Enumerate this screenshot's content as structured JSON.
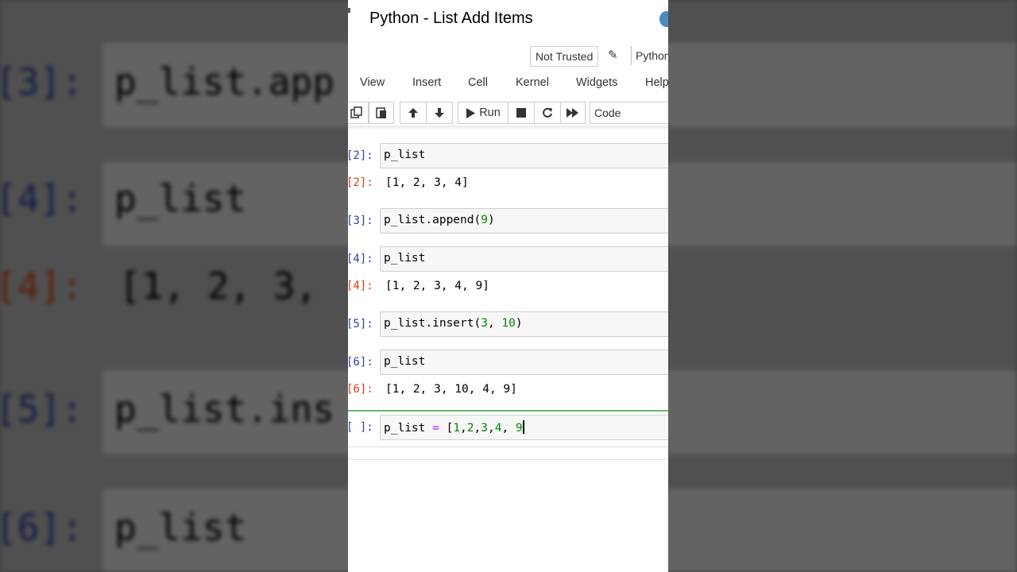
{
  "notebook": {
    "title": "Python - List Add Items",
    "trust_status": "Not Trusted",
    "kernel_name": "Python",
    "menu": [
      "View",
      "Insert",
      "Cell",
      "Kernel",
      "Widgets",
      "Help"
    ],
    "toolbar": {
      "run_label": "Run",
      "cell_type": "Code"
    },
    "cells": [
      {
        "in_prompt": "[2]:",
        "code": "p_list",
        "out_prompt": "[2]:",
        "output": "[1, 2, 3, 4]"
      },
      {
        "in_prompt": "[3]:",
        "code_parts": [
          "p_list.append(",
          "9",
          ")"
        ]
      },
      {
        "in_prompt": "[4]:",
        "code": "p_list",
        "out_prompt": "[4]:",
        "output": "[1, 2, 3, 4, 9]"
      },
      {
        "in_prompt": "[5]:",
        "code_parts": [
          "p_list.insert(",
          "3",
          ", ",
          "10",
          ")"
        ]
      },
      {
        "in_prompt": "[6]:",
        "code": "p_list",
        "out_prompt": "[6]:",
        "output": "[1, 2, 3, 10, 4, 9]"
      },
      {
        "in_prompt": "[ ]:",
        "code_parts": [
          "p_list ",
          "=",
          " [",
          "1",
          ",",
          "2",
          ",",
          "3",
          ",",
          "4",
          ", ",
          "9"
        ]
      }
    ]
  },
  "background": {
    "rows": [
      {
        "prompt": "[3]:",
        "code": "p_list.app"
      },
      {
        "prompt": "[4]:",
        "code": "p_list"
      },
      {
        "prompt": "[4]:",
        "output": "[1, 2, 3,"
      },
      {
        "prompt": "[5]:",
        "code": "p_list.ins"
      },
      {
        "prompt": "[6]:",
        "code": "p_list"
      }
    ]
  },
  "colors": {
    "prompt_in": "#303f9f",
    "prompt_out": "#d84315",
    "number": "#008800",
    "operator": "#aa22ff",
    "selected_cell": "#66bb6a"
  }
}
